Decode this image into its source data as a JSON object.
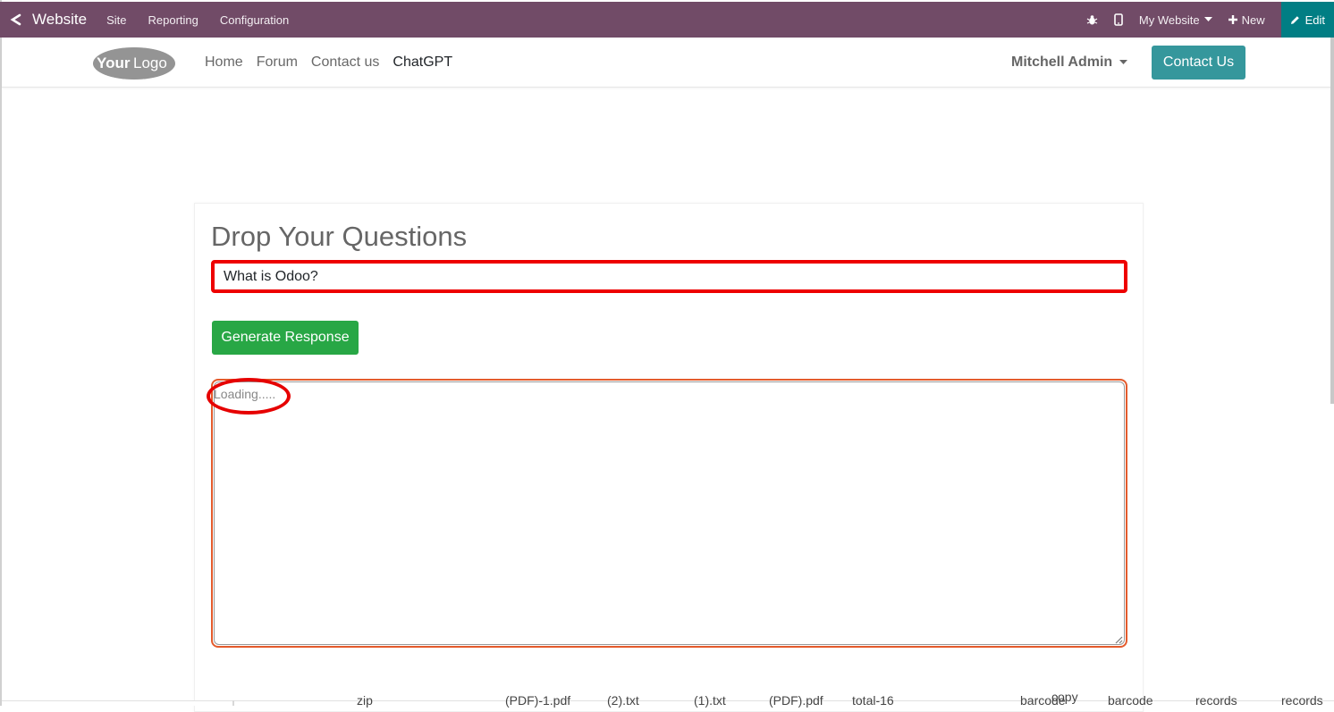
{
  "topbar": {
    "app_name": "Website",
    "menus": [
      "Site",
      "Reporting",
      "Configuration"
    ],
    "my_website": "My Website",
    "new_label": "New",
    "edit_label": "Edit"
  },
  "header": {
    "logo_text_1": "Your",
    "logo_text_2": "Logo",
    "nav": [
      "Home",
      "Forum",
      "Contact us",
      "ChatGPT"
    ],
    "active_nav": "ChatGPT",
    "user_name": "Mitchell Admin",
    "contact_button": "Contact Us"
  },
  "main": {
    "heading": "Drop Your Questions",
    "question_value": "What is Odoo?",
    "generate_button": "Generate Response",
    "response_text": "Loading....."
  },
  "colors": {
    "topbar": "#714b67",
    "edit": "#017e84",
    "contact": "#35979c",
    "generate": "#28a745",
    "highlight": "#ee0000"
  },
  "clipped_footer": [
    "zip",
    "(PDF)-1.pdf",
    "(2).txt",
    "(1).txt",
    "(PDF).pdf",
    "total-16",
    "barcode",
    "barcode",
    "records",
    "records",
    "copy"
  ]
}
